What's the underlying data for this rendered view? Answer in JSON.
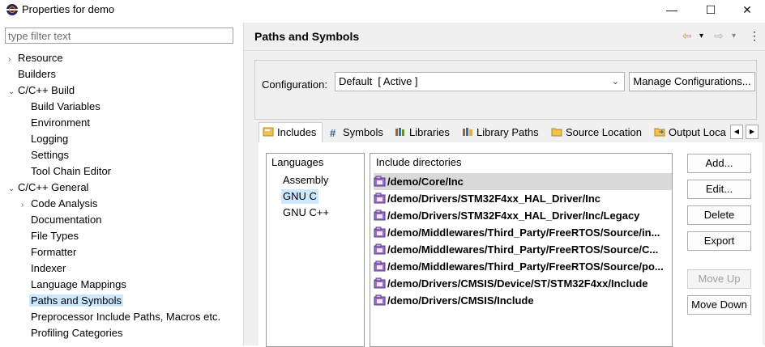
{
  "window": {
    "title": "Properties for demo",
    "minimize": "—",
    "maximize": "☐",
    "close": "✕"
  },
  "filter": {
    "placeholder": "type filter text",
    "value": ""
  },
  "tree": [
    {
      "label": "Resource",
      "level": 0,
      "toggle": "›"
    },
    {
      "label": "Builders",
      "level": 0,
      "toggle": ""
    },
    {
      "label": "C/C++ Build",
      "level": 0,
      "toggle": "⌄"
    },
    {
      "label": "Build Variables",
      "level": 1,
      "toggle": ""
    },
    {
      "label": "Environment",
      "level": 1,
      "toggle": ""
    },
    {
      "label": "Logging",
      "level": 1,
      "toggle": ""
    },
    {
      "label": "Settings",
      "level": 1,
      "toggle": ""
    },
    {
      "label": "Tool Chain Editor",
      "level": 1,
      "toggle": ""
    },
    {
      "label": "C/C++ General",
      "level": 0,
      "toggle": "⌄"
    },
    {
      "label": "Code Analysis",
      "level": 1,
      "toggle": "›"
    },
    {
      "label": "Documentation",
      "level": 1,
      "toggle": ""
    },
    {
      "label": "File Types",
      "level": 1,
      "toggle": ""
    },
    {
      "label": "Formatter",
      "level": 1,
      "toggle": ""
    },
    {
      "label": "Indexer",
      "level": 1,
      "toggle": ""
    },
    {
      "label": "Language Mappings",
      "level": 1,
      "toggle": ""
    },
    {
      "label": "Paths and Symbols",
      "level": 1,
      "toggle": "",
      "selected": true
    },
    {
      "label": "Preprocessor Include Paths, Macros etc.",
      "level": 1,
      "toggle": ""
    },
    {
      "label": "Profiling Categories",
      "level": 1,
      "toggle": ""
    }
  ],
  "header": {
    "title": "Paths and Symbols",
    "back": "⇦",
    "forward": "⇨",
    "dropdown": "▾",
    "menu": "⋮"
  },
  "configuration": {
    "label": "Configuration:",
    "value": "Default  [ Active ]",
    "chevron": "⌄",
    "manage_button": "Manage Configurations..."
  },
  "tabs": [
    {
      "label": "Includes",
      "icon": "includes-icon",
      "active": true
    },
    {
      "label": "Symbols",
      "icon": "hash-icon"
    },
    {
      "label": "Libraries",
      "icon": "libraries-icon"
    },
    {
      "label": "Library Paths",
      "icon": "library-paths-icon"
    },
    {
      "label": "Source Location",
      "icon": "folder-icon"
    },
    {
      "label": "Output Loca",
      "icon": "output-folder-icon"
    }
  ],
  "tab_scroll": {
    "left": "◀",
    "right": "▶"
  },
  "languages": {
    "header": "Languages",
    "items": [
      {
        "label": "Assembly"
      },
      {
        "label": "GNU C",
        "selected": true
      },
      {
        "label": "GNU C++"
      }
    ]
  },
  "includes": {
    "header": "Include directories",
    "rows": [
      {
        "path": "/demo/Core/Inc",
        "selected": true
      },
      {
        "path": "/demo/Drivers/STM32F4xx_HAL_Driver/Inc"
      },
      {
        "path": "/demo/Drivers/STM32F4xx_HAL_Driver/Inc/Legacy"
      },
      {
        "path": "/demo/Middlewares/Third_Party/FreeRTOS/Source/in..."
      },
      {
        "path": "/demo/Middlewares/Third_Party/FreeRTOS/Source/C..."
      },
      {
        "path": "/demo/Middlewares/Third_Party/FreeRTOS/Source/po..."
      },
      {
        "path": "/demo/Drivers/CMSIS/Device/ST/STM32F4xx/Include"
      },
      {
        "path": "/demo/Drivers/CMSIS/Include"
      }
    ]
  },
  "actions": {
    "add": "Add...",
    "edit": "Edit...",
    "delete": "Delete",
    "export": "Export",
    "move_up": "Move Up",
    "move_down": "Move Down"
  },
  "colors": {
    "selection": "#cce8ff",
    "pane_background": "#f0f0f0",
    "include_icon": "#7b4fa8"
  }
}
